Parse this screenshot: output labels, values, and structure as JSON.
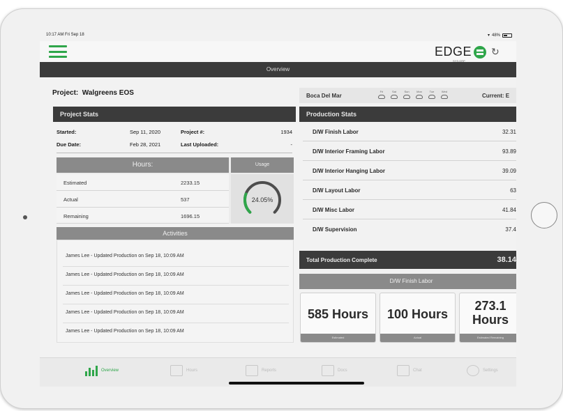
{
  "status": {
    "time": "10:17 AM  Fri Sep 18",
    "battery": "48%"
  },
  "header": {
    "logo": "EDGE",
    "logo_sub": "SYS.GRP"
  },
  "titlebar": "Overview",
  "project": {
    "label": "Project:",
    "name": "Walgreens EOS"
  },
  "project_stats": {
    "title": "Project Stats",
    "started_label": "Started:",
    "started": "Sep 11, 2020",
    "due_label": "Due Date:",
    "due": "Feb 28, 2021",
    "project_num_label": "Project #:",
    "project_num": "1934",
    "last_uploaded_label": "Last Uploaded:",
    "last_uploaded": "-"
  },
  "hours": {
    "title": "Hours:",
    "usage_title": "Usage",
    "rows": [
      {
        "label": "Estimated",
        "value": "2233.15"
      },
      {
        "label": "Actual",
        "value": "537"
      },
      {
        "label": "Remaining",
        "value": "1696.15"
      }
    ],
    "usage_percent": "24.05%",
    "usage_fraction": 0.2405
  },
  "activities": {
    "title": "Activities",
    "items": [
      "James Lee - Updated Production on Sep 18, 10:09 AM",
      "James Lee - Updated Production on Sep 18, 10:09 AM",
      "James Lee - Updated Production on Sep 18, 10:09 AM",
      "James Lee - Updated Production on Sep 18, 10:09 AM",
      "James Lee - Updated Production on Sep 18, 10:09 AM"
    ]
  },
  "weather": {
    "location": "Boca Del Mar",
    "days": [
      "Fri",
      "Sat",
      "Sun",
      "Mon",
      "Tue",
      "Wed"
    ],
    "current": "Current: E"
  },
  "production": {
    "title": "Production Stats",
    "rows": [
      {
        "label": "D/W Finish Labor",
        "value": "32.31"
      },
      {
        "label": "D/W Interior Framing Labor",
        "value": "93.89"
      },
      {
        "label": "D/W Interior Hanging Labor",
        "value": "39.09"
      },
      {
        "label": "D/W Layout Labor",
        "value": "63"
      },
      {
        "label": "D/W Misc Labor",
        "value": "41.84"
      },
      {
        "label": "D/W Supervision",
        "value": "37.4"
      }
    ],
    "total_label": "Total Production Complete",
    "total_value": "38.14"
  },
  "finish_labor": {
    "title": "D/W Finish Labor",
    "metrics": [
      {
        "value": "585 Hours",
        "caption": "Estimated"
      },
      {
        "value": "100 Hours",
        "caption": "Actual"
      },
      {
        "value_line1": "273.1",
        "value_line2": "Hours",
        "caption": "Estimated Remaining"
      }
    ]
  },
  "tabs": [
    {
      "label": "Overview"
    },
    {
      "label": "Hours"
    },
    {
      "label": "Reports"
    },
    {
      "label": "Docs"
    },
    {
      "label": "Chat"
    },
    {
      "label": "Settings"
    }
  ],
  "colors": {
    "accent": "#2fa64a",
    "dark": "#3b3b3b",
    "mid": "#8a8a8a"
  }
}
